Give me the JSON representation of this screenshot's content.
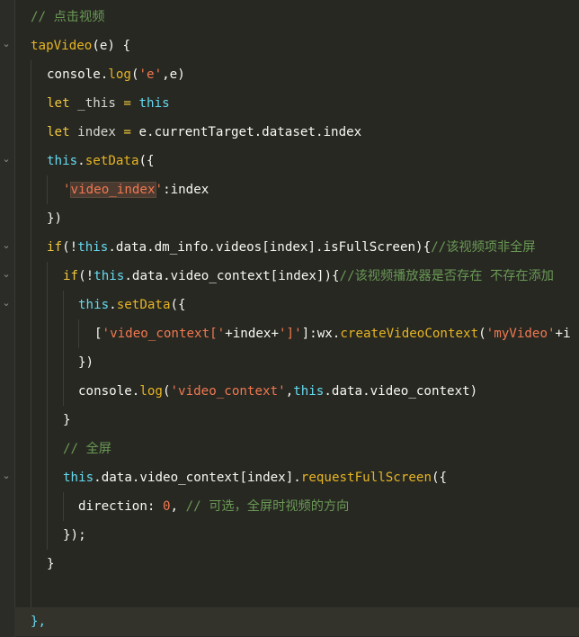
{
  "editor": {
    "lines": [
      {
        "indent": 34,
        "tokens": [
          {
            "t": "// 点击视频",
            "k": "c"
          }
        ]
      },
      {
        "indent": 34,
        "tokens": [
          {
            "t": "tapVideo",
            "k": "fn"
          },
          {
            "t": "(e) {",
            "k": "p"
          }
        ]
      },
      {
        "indent": 52,
        "tokens": [
          {
            "t": "console.",
            "k": "p"
          },
          {
            "t": "log",
            "k": "fm"
          },
          {
            "t": "(",
            "k": "p"
          },
          {
            "t": "'e'",
            "k": "str"
          },
          {
            "t": ",e)",
            "k": "p"
          }
        ]
      },
      {
        "indent": 52,
        "tokens": [
          {
            "t": "let",
            "k": "kw"
          },
          {
            "t": " _this ",
            "k": "var"
          },
          {
            "t": "=",
            "k": "kw"
          },
          {
            "t": " ",
            "k": "p"
          },
          {
            "t": "this",
            "k": "th"
          }
        ]
      },
      {
        "indent": 52,
        "tokens": [
          {
            "t": "let",
            "k": "kw"
          },
          {
            "t": " index ",
            "k": "var"
          },
          {
            "t": "=",
            "k": "kw"
          },
          {
            "t": " e.currentTarget.dataset.index",
            "k": "p"
          }
        ]
      },
      {
        "indent": 52,
        "tokens": [
          {
            "t": "this",
            "k": "th"
          },
          {
            "t": ".",
            "k": "p"
          },
          {
            "t": "setData",
            "k": "fm"
          },
          {
            "t": "({",
            "k": "p"
          }
        ]
      },
      {
        "indent": 70,
        "tokens": [
          {
            "t": "'",
            "k": "str"
          },
          {
            "t": "video_index",
            "k": "str",
            "sel": true
          },
          {
            "t": "'",
            "k": "str"
          },
          {
            "t": ":index",
            "k": "p"
          }
        ]
      },
      {
        "indent": 52,
        "tokens": [
          {
            "t": "})",
            "k": "p"
          }
        ]
      },
      {
        "indent": 52,
        "tokens": [
          {
            "t": "if",
            "k": "kw"
          },
          {
            "t": "(!",
            "k": "p"
          },
          {
            "t": "this",
            "k": "th"
          },
          {
            "t": ".data.dm_info.videos[index].isFullScreen){",
            "k": "p"
          },
          {
            "t": "//该视频项非全屏",
            "k": "c"
          }
        ]
      },
      {
        "indent": 70,
        "tokens": [
          {
            "t": "if",
            "k": "kw"
          },
          {
            "t": "(!",
            "k": "p"
          },
          {
            "t": "this",
            "k": "th"
          },
          {
            "t": ".data.video_context[index]){",
            "k": "p"
          },
          {
            "t": "//该视频播放器是否存在 不存在添加",
            "k": "c"
          }
        ]
      },
      {
        "indent": 87,
        "tokens": [
          {
            "t": "this",
            "k": "th"
          },
          {
            "t": ".",
            "k": "p"
          },
          {
            "t": "setData",
            "k": "fm"
          },
          {
            "t": "({",
            "k": "p"
          }
        ]
      },
      {
        "indent": 105,
        "tokens": [
          {
            "t": "[",
            "k": "p"
          },
          {
            "t": "'video_context['",
            "k": "str"
          },
          {
            "t": "+index+",
            "k": "p"
          },
          {
            "t": "']'",
            "k": "str"
          },
          {
            "t": "]:wx.",
            "k": "p"
          },
          {
            "t": "createVideoContext",
            "k": "fm"
          },
          {
            "t": "(",
            "k": "p"
          },
          {
            "t": "'myVideo'",
            "k": "str"
          },
          {
            "t": "+i",
            "k": "p"
          }
        ]
      },
      {
        "indent": 87,
        "tokens": [
          {
            "t": "})",
            "k": "p"
          }
        ]
      },
      {
        "indent": 87,
        "tokens": [
          {
            "t": "console.",
            "k": "p"
          },
          {
            "t": "log",
            "k": "fm"
          },
          {
            "t": "(",
            "k": "p"
          },
          {
            "t": "'video_context'",
            "k": "str"
          },
          {
            "t": ",",
            "k": "p"
          },
          {
            "t": "this",
            "k": "th"
          },
          {
            "t": ".data.video_context)",
            "k": "p"
          }
        ]
      },
      {
        "indent": 70,
        "tokens": [
          {
            "t": "}",
            "k": "p"
          }
        ]
      },
      {
        "indent": 70,
        "tokens": [
          {
            "t": "// 全屏",
            "k": "c"
          }
        ]
      },
      {
        "indent": 70,
        "tokens": [
          {
            "t": "this",
            "k": "th"
          },
          {
            "t": ".data.video_context[index].",
            "k": "p"
          },
          {
            "t": "requestFullScreen",
            "k": "fm"
          },
          {
            "t": "({",
            "k": "p"
          }
        ]
      },
      {
        "indent": 87,
        "tokens": [
          {
            "t": "direction",
            "k": "p"
          },
          {
            "t": ": ",
            "k": "p"
          },
          {
            "t": "0",
            "k": "num"
          },
          {
            "t": ", ",
            "k": "p"
          },
          {
            "t": "// 可选，全屏时视频的方向",
            "k": "c"
          }
        ]
      },
      {
        "indent": 70,
        "tokens": [
          {
            "t": "});",
            "k": "p"
          }
        ]
      },
      {
        "indent": 52,
        "tokens": [
          {
            "t": "}",
            "k": "p"
          }
        ]
      },
      {
        "indent": 34,
        "tokens": []
      },
      {
        "indent": 34,
        "tokens": [
          {
            "t": "},",
            "k": "br"
          }
        ]
      }
    ],
    "fold_markers": [
      {
        "line": 1,
        "glyph": "⌄"
      },
      {
        "line": 5,
        "glyph": "⌄"
      },
      {
        "line": 8,
        "glyph": "⌄"
      },
      {
        "line": 9,
        "glyph": "⌄"
      },
      {
        "line": 10,
        "glyph": "⌄"
      },
      {
        "line": 16,
        "glyph": "⌄"
      }
    ],
    "highlighted_line": 21,
    "colors": {
      "background": "#272822",
      "comment": "#6a9955",
      "keyword": "#f0c73e",
      "string": "#f07850",
      "this": "#66d9ef",
      "function": "#e6b422"
    }
  }
}
